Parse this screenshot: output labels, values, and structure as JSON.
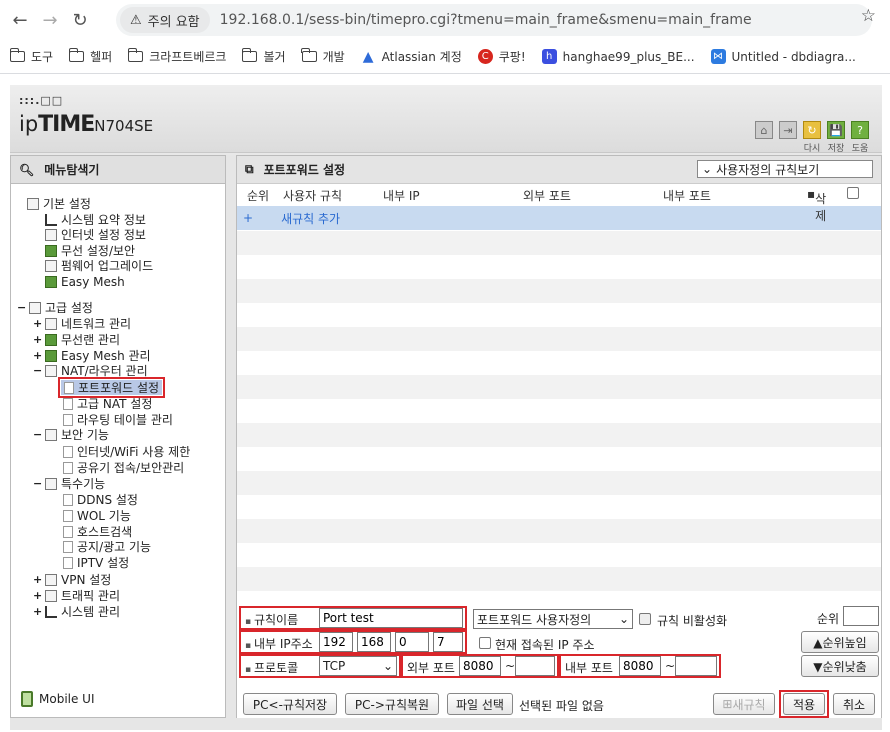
{
  "browser": {
    "security_label": "주의 요함",
    "url": "192.168.0.1/sess-bin/timepro.cgi?tmenu=main_frame&smenu=main_frame",
    "bookmarks": [
      "도구",
      "헬퍼",
      "크라프트베르크",
      "볼거",
      "개발",
      "Atlassian 계정",
      "쿠팡!",
      "hanghae99_plus_BE...",
      "Untitled - dbdiagra..."
    ]
  },
  "header": {
    "logo_top": ":::.□□",
    "logo_brand_prefix": "ip",
    "logo_brand": "TIME",
    "logo_model": "N704SE",
    "tools": [
      {
        "label": "다시",
        "icon": "home-icon"
      },
      {
        "label": "저장",
        "icon": "logout-icon"
      },
      {
        "label": "도움",
        "icon": "save-icon"
      }
    ],
    "tool_top_icons": [
      "⌂",
      "⇥",
      "↻",
      "💾",
      "?"
    ]
  },
  "sidebar": {
    "title": "메뉴탐색기",
    "groups": {
      "basic": "기본 설정",
      "basic_items": [
        "시스템 요약 정보",
        "인터넷 설정 정보",
        "무선 설정/보안",
        "펌웨어 업그레이드",
        "Easy Mesh"
      ],
      "advanced": "고급 설정",
      "network": "네트워크 관리",
      "wireless": "무선랜 관리",
      "easymesh": "Easy Mesh 관리",
      "nat": "NAT/라우터 관리",
      "nat_items": [
        "포트포워드 설정",
        "고급 NAT 설정",
        "라우팅 테이블 관리"
      ],
      "security": "보안 기능",
      "security_items": [
        "인터넷/WiFi 사용 제한",
        "공유기 접속/보안관리"
      ],
      "special": "특수기능",
      "special_items": [
        "DDNS 설정",
        "WOL 기능",
        "호스트검색",
        "공지/광고 기능",
        "IPTV 설정"
      ],
      "vpn": "VPN 설정",
      "traffic": "트래픽 관리",
      "system": "시스템 관리"
    },
    "mobile": "Mobile UI"
  },
  "main": {
    "title": "포트포워드 설정",
    "view_select": "사용자정의 규칙보기",
    "columns": [
      "순위",
      "사용자 규칙",
      "내부 IP",
      "외부 포트",
      "내부 포트",
      "삭제"
    ],
    "add_plus": "+",
    "add_rule": "새규칙 추가",
    "form": {
      "rule_name_label": "규칙이름",
      "rule_name_value": "Port test",
      "rule_type": "포트포워드 사용자정의",
      "disable_label": "규칙 비활성화",
      "ip_label": "내부 IP주소",
      "ip": [
        "192",
        "168",
        "0",
        "7"
      ],
      "current_ip_label": "현재 접속된 IP 주소",
      "protocol_label": "프로토콜",
      "protocol_value": "TCP",
      "ext_port_label": "외부 포트",
      "ext_port_from": "8080",
      "int_port_label": "내부 포트",
      "int_port_from": "8080",
      "tilde": "~",
      "priority_label": "순위",
      "up_button": "▲순위높임",
      "down_button": "▼순위낮춤"
    },
    "buttons": {
      "backup": "PC<-규칙저장",
      "restore": "PC->규칙복원",
      "file_select": "파일 선택",
      "file_status": "선택된 파일 없음",
      "new_rule": "새규칙",
      "apply": "적용",
      "cancel": "취소"
    }
  }
}
